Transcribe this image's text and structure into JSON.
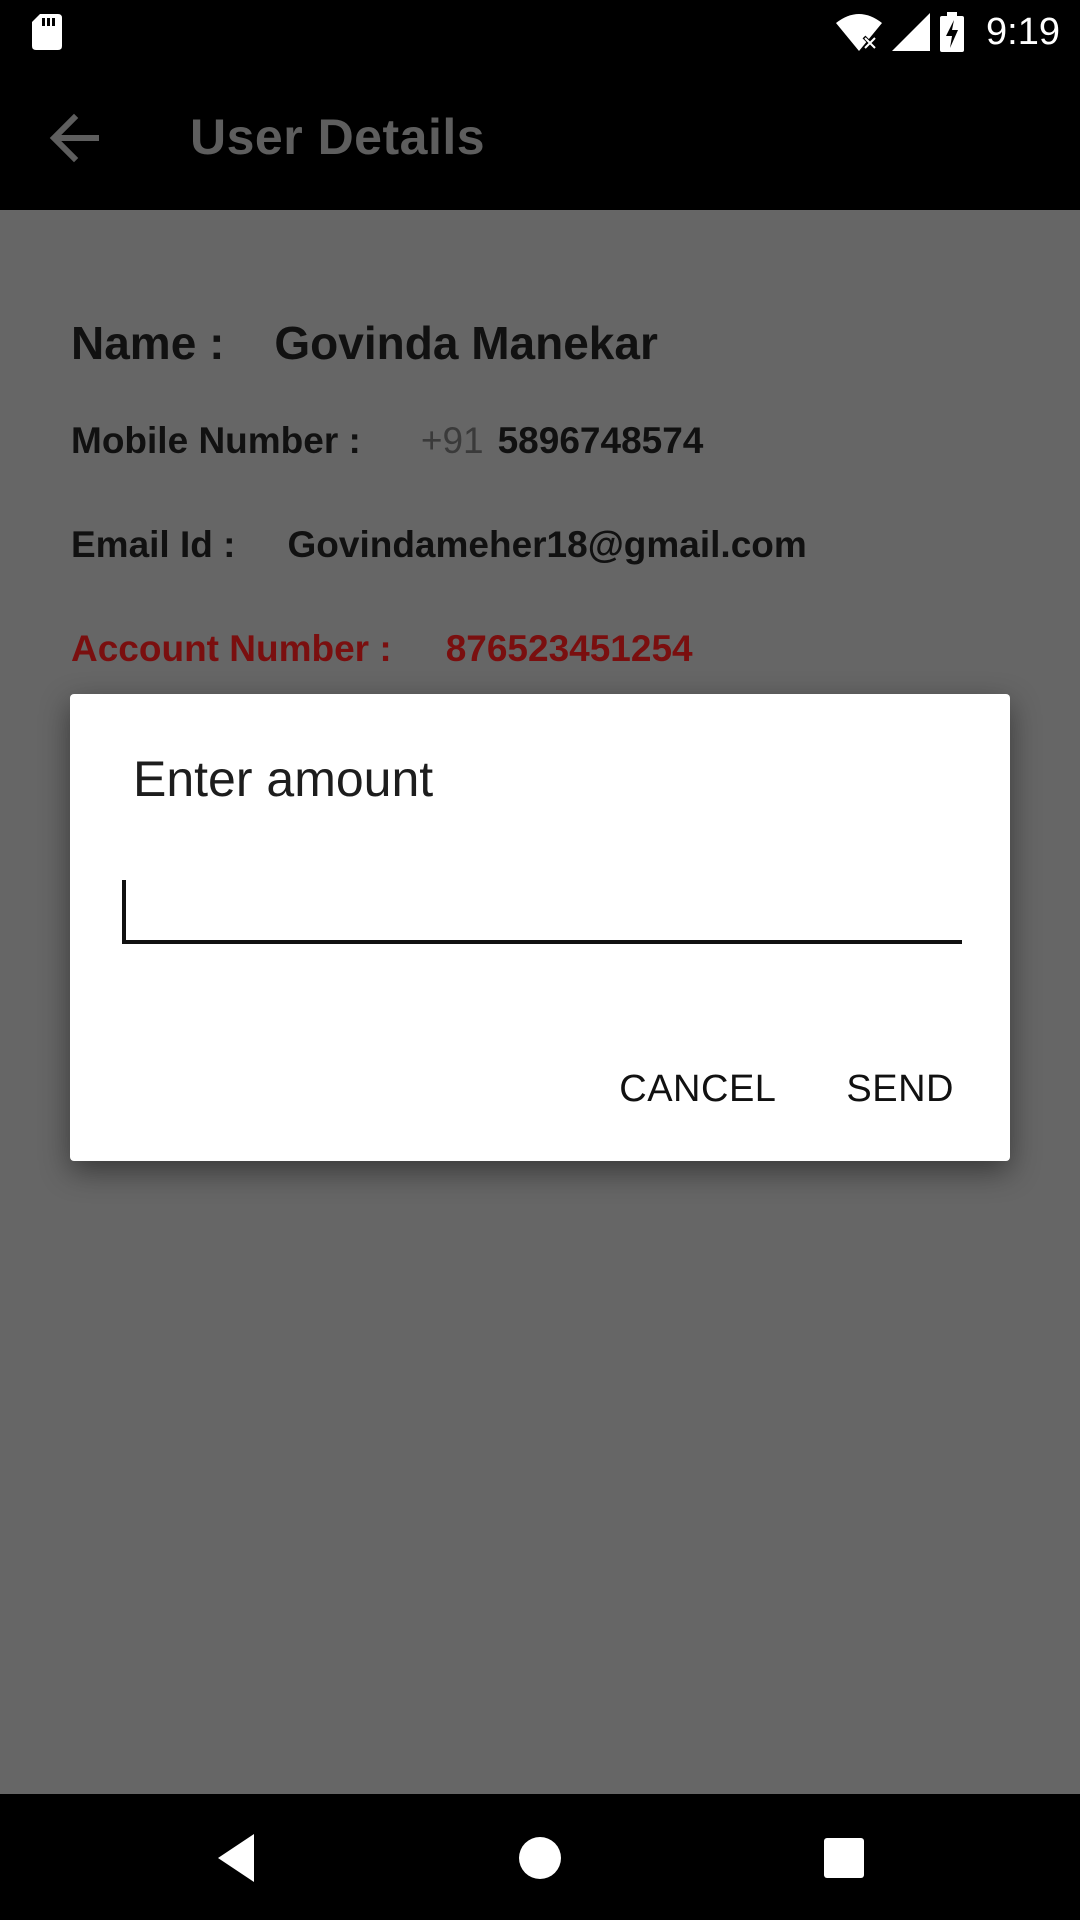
{
  "status_bar": {
    "time": "9:19",
    "icons": [
      "sd-card-icon",
      "wifi-off-icon",
      "cell-signal-icon",
      "battery-charging-icon"
    ]
  },
  "app_bar": {
    "title": "User Details",
    "back_icon": "back-arrow-icon"
  },
  "details": {
    "name_label": "Name :",
    "name_value": "Govinda Manekar",
    "mobile_label": "Mobile Number :",
    "mobile_prefix": "+91",
    "mobile_value": "5896748574",
    "email_label": "Email Id :",
    "email_value": "Govindameher18@gmail.com",
    "account_label": "Account Number :",
    "account_value": "876523451254"
  },
  "dialog": {
    "title": "Enter amount",
    "input_value": "",
    "cancel_label": "CANCEL",
    "send_label": "SEND"
  },
  "nav_bar": {
    "icons": [
      "nav-back-icon",
      "nav-home-icon",
      "nav-recents-icon"
    ]
  },
  "colors": {
    "scrim_background": "#666666",
    "bar_background": "#000000",
    "account_text": "#7a0f0f",
    "dialog_background": "#ffffff"
  }
}
